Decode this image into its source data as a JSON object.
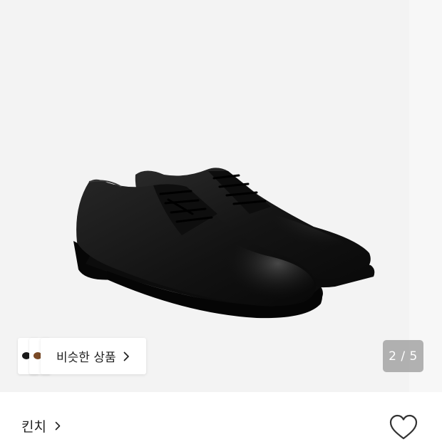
{
  "product_image": {
    "icon": "black-leather-derby-shoes-image"
  },
  "similar_products": {
    "label": "비슷한 상품",
    "thumbnails": [
      "black-shoe-thumbnail",
      "brown-shoe-thumbnail"
    ]
  },
  "pagination": {
    "text": "2 / 5",
    "current": 2,
    "total": 5
  },
  "brand": {
    "name": "킨치"
  },
  "wishlist": {
    "icon": "heart-icon"
  },
  "colors": {
    "image_background": "#f3f3f3",
    "indicator_background": "#8c8c8c",
    "text": "#222222"
  }
}
